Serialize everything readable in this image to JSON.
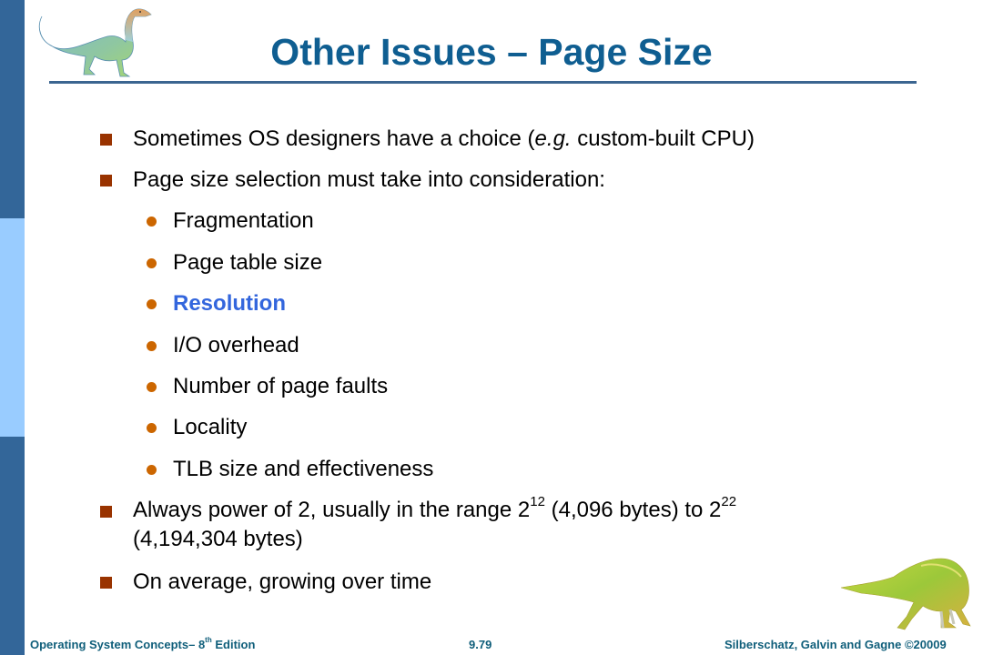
{
  "slide": {
    "title": "Other Issues – Page Size",
    "bullets": [
      {
        "pre": "Sometimes OS designers have a choice (",
        "italic": "e.g.",
        "post": " custom-built CPU)"
      },
      {
        "text": "Page size selection must take into consideration:"
      }
    ],
    "sub_bullets": [
      {
        "text": "Fragmentation",
        "highlight": false
      },
      {
        "text": "Page table size",
        "highlight": false
      },
      {
        "text": "Resolution",
        "highlight": true
      },
      {
        "text": "I/O overhead",
        "highlight": false
      },
      {
        "text": "Number of page faults",
        "highlight": false
      },
      {
        "text": "Locality",
        "highlight": false
      },
      {
        "text": "TLB size and effectiveness",
        "highlight": false
      }
    ],
    "power_bullet": {
      "part1": "Always power of 2, usually in the range 2",
      "exp1": "12",
      "part2": " (4,096 bytes) to 2",
      "exp2": "22",
      "line2": "(4,194,304 bytes)"
    },
    "last_bullet": "On average, growing over time"
  },
  "footer": {
    "book": "Operating System Concepts– 8",
    "edition_sup": "th",
    "edition": " Edition",
    "page": "9.79",
    "authors": "Silberschatz, Galvin and Gagne ©20009"
  },
  "colors": {
    "title": "#0f5e91",
    "sidebar_dark": "#336699",
    "sidebar_light": "#99ccff",
    "bullet_square": "#993300",
    "bullet_dot": "#cc6600",
    "highlight": "#3366dd"
  }
}
